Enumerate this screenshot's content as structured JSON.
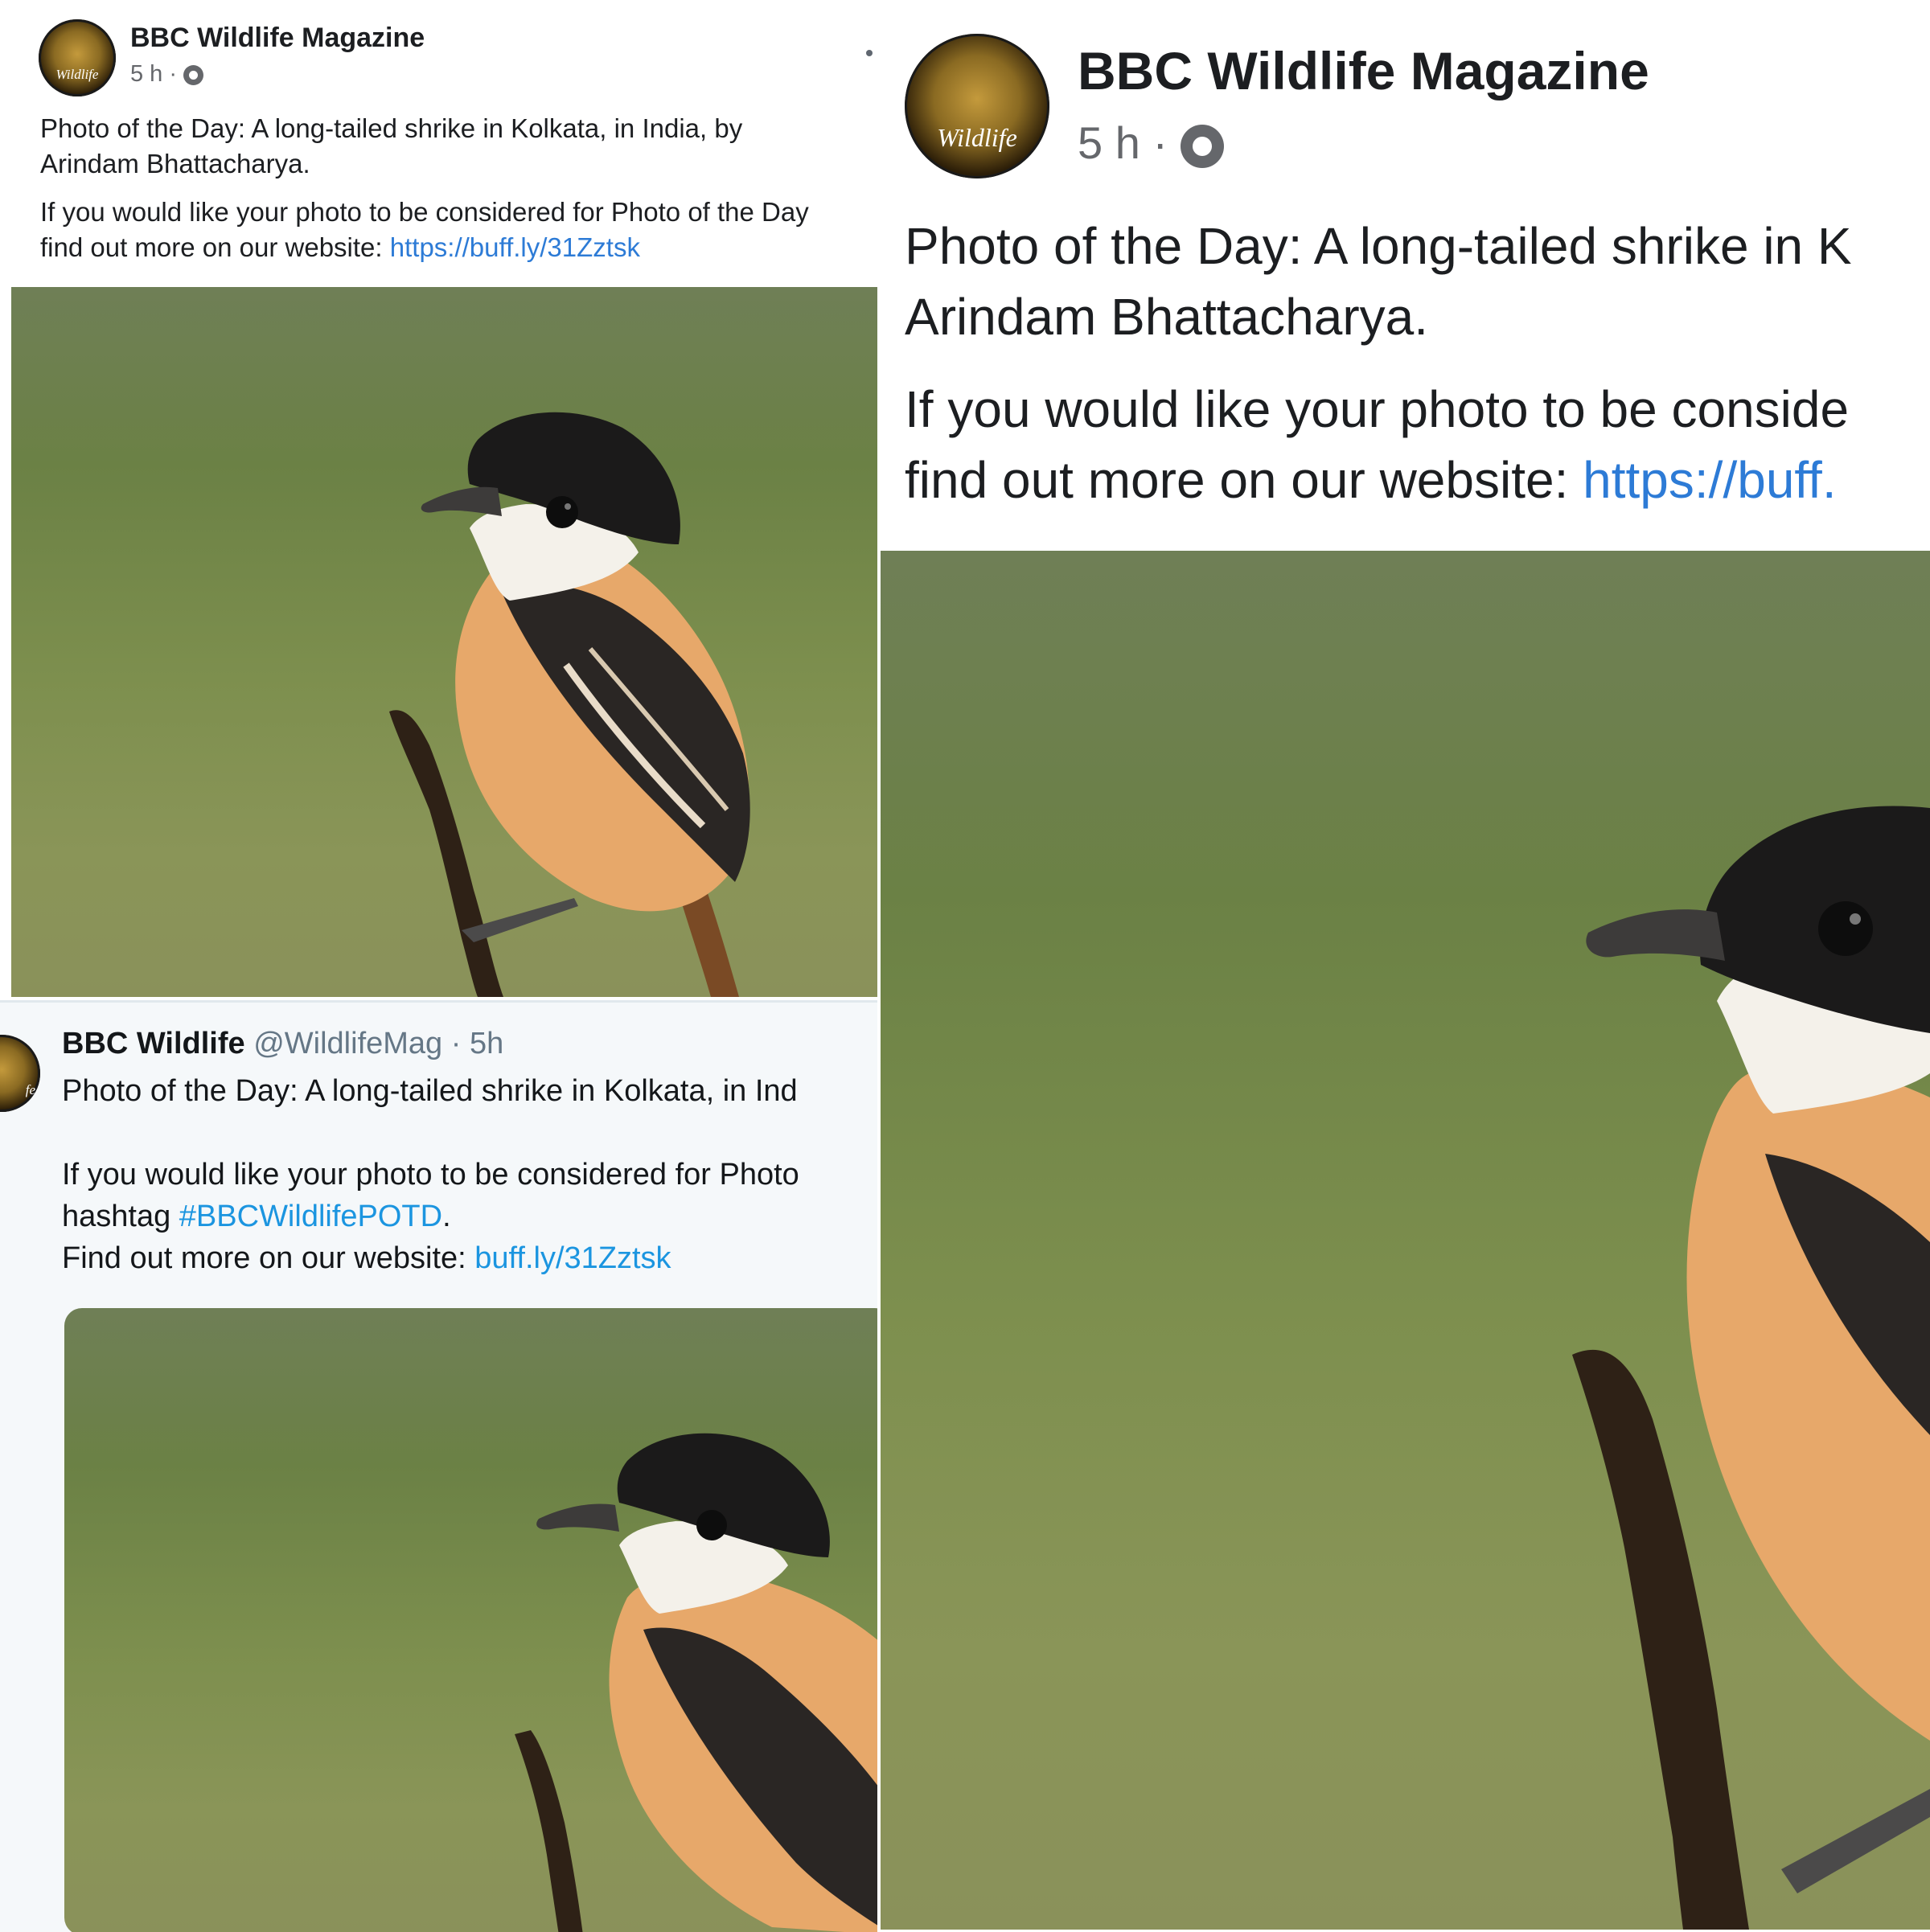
{
  "facebook_post": {
    "page_name": "BBC Wildlife Magazine",
    "timestamp": "5 h",
    "separator": "·",
    "privacy_icon": "globe-icon",
    "avatar_text": "Wildlife",
    "caption_line1": "Photo of the Day: A long-tailed shrike in Kolkata, in India, by",
    "caption_line2": "Arindam Bhattacharya.",
    "cta_line1": "If you would like your photo to be considered for Photo of the Day",
    "cta_line2_prefix": "find out more on our website: ",
    "link": "https://buff.ly/31Zztsk"
  },
  "facebook_post_zoomed": {
    "page_name": "BBC Wildlife Magazine",
    "timestamp": "5 h",
    "separator": "·",
    "avatar_text": "Wildlife",
    "caption_line1": "Photo of the Day: A long-tailed shrike in K",
    "caption_line2": "Arindam Bhattacharya.",
    "cta_line1": "If you would like your photo to be conside",
    "cta_line2_prefix": "find out more on our website: ",
    "link": "https://buff."
  },
  "tweet": {
    "display_name": "BBC Wildlife",
    "handle": "@WildlifeMag",
    "separator": "·",
    "time": "5h",
    "avatar_text": "fe",
    "line1": "Photo of the Day: A long-tailed shrike in Kolkata, in Ind",
    "line2": "If you would like your photo to be considered for Photo",
    "line3_prefix": "hashtag ",
    "hashtag": "#BBCWildlifePOTD",
    "line3_suffix": ".",
    "line4_prefix": "Find out more on our website: ",
    "link": "buff.ly/31Zztsk"
  },
  "colors": {
    "link_blue": "#2d7bd6",
    "twitter_blue": "#1b95e0",
    "text_dark": "#1c1e21",
    "meta_gray": "#65676b"
  }
}
